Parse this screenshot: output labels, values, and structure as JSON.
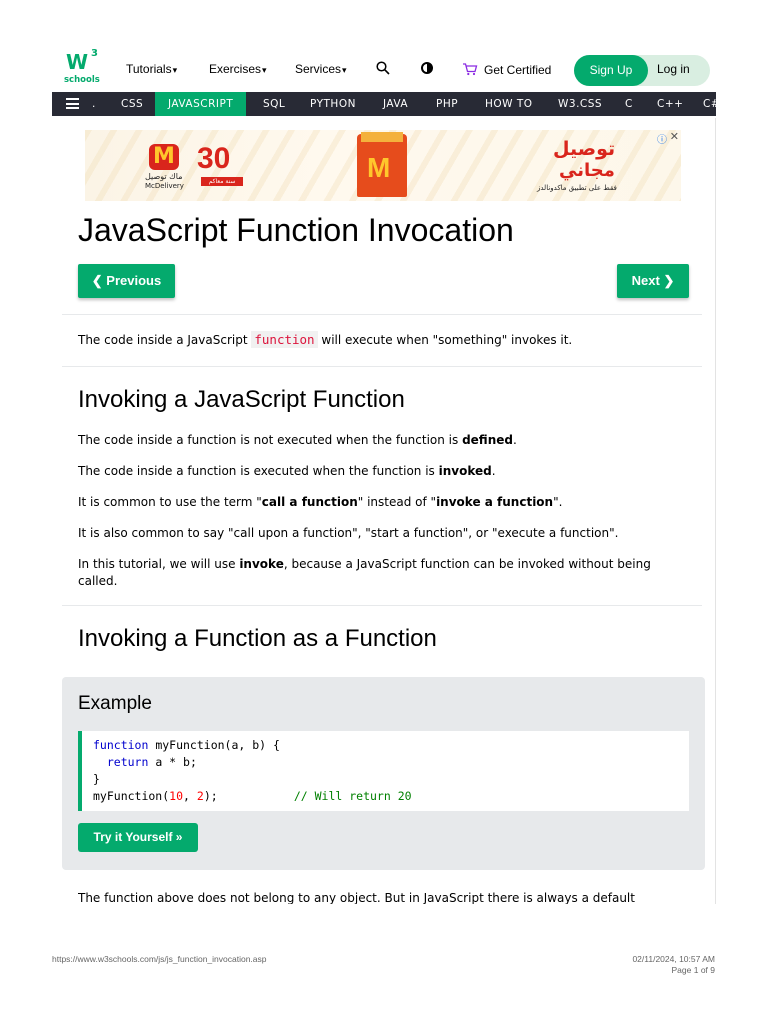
{
  "header": {
    "logo_mark": "W",
    "logo_sup": "3",
    "logo_text": "schools",
    "menu": [
      {
        "label": "Tutorials",
        "caret": "▾"
      },
      {
        "label": "Exercises",
        "caret": "▾"
      },
      {
        "label": "Services",
        "caret": "▾"
      }
    ],
    "icons": {
      "search": "search-icon",
      "theme": "contrast-icon",
      "cart": "cart-icon"
    },
    "get_certified": "Get Certified",
    "signup": "Sign Up",
    "login": "Log in"
  },
  "subjects": {
    "items": [
      ".",
      "CSS",
      "JAVASCRIPT",
      "SQL",
      "PYTHON",
      "JAVA",
      "PHP",
      "HOW TO",
      "W3.CSS",
      "C",
      "C++",
      "C#"
    ],
    "active": "JAVASCRIPT"
  },
  "ad": {
    "mc_logo": "M",
    "mc_text1": "ماك توصيل",
    "mc_text2": "McDelivery",
    "thirty": "30",
    "thirty_sub": "سنة معاكم",
    "bag_logo": "M",
    "arabic_line1": "توصيل",
    "arabic_line2": "مجاني",
    "arabic_line3": "فقط على تطبيق ماكدونالدز",
    "adchoice": "ⓘ",
    "close": "✕"
  },
  "page": {
    "title": "JavaScript Function Invocation",
    "prev_label": "❮ Previous",
    "next_label": "Next ❯",
    "intro_before": "The code inside a JavaScript ",
    "intro_code": "function",
    "intro_after": " will execute when \"something\" invokes it.",
    "section1": {
      "heading": "Invoking a JavaScript Function",
      "p1_text": "The code inside a function is not executed when the function is ",
      "p1_bold": "defined",
      "p1_end": ".",
      "p2_text": "The code inside a function is executed when the function is ",
      "p2_bold": "invoked",
      "p2_end": ".",
      "p3_a": "It is common to use the term \"",
      "p3_bold1": "call a function",
      "p3_b": "\" instead of \"",
      "p3_bold2": "invoke a function",
      "p3_c": "\".",
      "p4": "It is also common to say \"call upon a function\", \"start a function\", or \"execute a function\".",
      "p5_a": "In this tutorial, we will use ",
      "p5_bold": "invoke",
      "p5_b": ", because a JavaScript function can be invoked without being called."
    },
    "section2": {
      "heading": "Invoking a Function as a Function",
      "example_title": "Example",
      "code": {
        "l1_kw": "function",
        "l1_rest": " myFunction(a, b) {",
        "l2_indent": "  ",
        "l2_kw": "return",
        "l2_rest": " a * b;",
        "l3": "}",
        "l4_a": "myFunction(",
        "l4_n1": "10",
        "l4_b": ", ",
        "l4_n2": "2",
        "l4_c": ");           ",
        "l4_cmt": "// Will return 20"
      },
      "tryit_label": "Try it Yourself »",
      "after_text": "The function above does not belong to any object. But in JavaScript there is always a default"
    }
  },
  "print_footer": {
    "url": "https://www.w3schools.com/js/js_function_invocation.asp",
    "datetime": "02/11/2024, 10:57 AM",
    "page": "Page 1 of 9"
  }
}
